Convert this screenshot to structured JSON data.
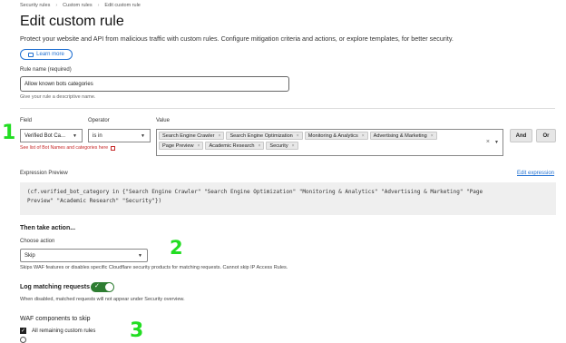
{
  "breadcrumb": [
    "Security rules",
    "Custom rules",
    "Edit custom rule"
  ],
  "page": {
    "title": "Edit custom rule",
    "description": "Protect your website and API from malicious traffic with custom rules. Configure mitigation criteria and actions, or explore templates, for better security.",
    "learn_more": "Learn more"
  },
  "rule_name": {
    "label": "Rule name (required)",
    "value": "Allow known bots categories",
    "hint": "Give your rule a descriptive name."
  },
  "expression_builder": {
    "field_label": "Field",
    "operator_label": "Operator",
    "value_label": "Value",
    "field_value": "Verified Bot Ca...",
    "operator_value": "is in",
    "bot_list_link": "See list of Bot Names and categories here",
    "values": [
      "Search Engine Crawler",
      "Search Engine Optimization",
      "Monitoring & Analytics",
      "Advertising & Marketing",
      "Page Preview",
      "Academic Research",
      "Security"
    ],
    "and_label": "And",
    "or_label": "Or"
  },
  "preview": {
    "label": "Expression Preview",
    "edit_link": "Edit expression",
    "line1": "(cf.verified_bot_category in {\"Search Engine Crawler\" \"Search Engine Optimization\" \"Monitoring & Analytics\" \"Advertising & Marketing\" \"Page",
    "line2": "Preview\" \"Academic Research\" \"Security\"})"
  },
  "action": {
    "heading": "Then take action...",
    "choose_label": "Choose action",
    "value": "Skip",
    "hint": "Skips WAF features or disables specific Cloudflare security products for matching requests. Cannot skip IP Access Rules."
  },
  "logging": {
    "label": "Log matching requests",
    "enabled": true,
    "hint": "When disabled, matched requests will not appear under Security overview."
  },
  "waf": {
    "heading": "WAF components to skip",
    "items": [
      {
        "label": "All remaining custom rules",
        "checked": true
      }
    ]
  },
  "annotations": [
    "1",
    "2",
    "3"
  ]
}
